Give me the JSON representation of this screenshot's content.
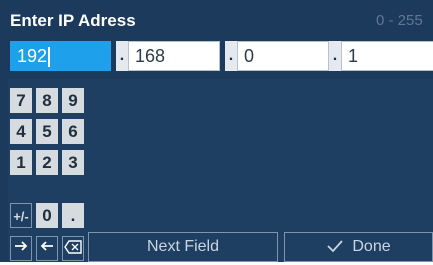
{
  "title": "Enter IP Adress",
  "range_hint": "0 - 255",
  "octets": [
    "192",
    "168",
    "0",
    "1"
  ],
  "separator": ".",
  "keypad": {
    "rows": [
      [
        "7",
        "8",
        "9"
      ],
      [
        "4",
        "5",
        "6"
      ],
      [
        "1",
        "2",
        "3"
      ],
      [
        "+/-",
        "0",
        "."
      ]
    ]
  },
  "actions": {
    "next_right_icon": "arrow-right-icon",
    "prev_left_icon": "arrow-left-icon",
    "backspace_icon": "backspace-icon",
    "next_field_label": "Next Field",
    "done_label": "Done",
    "done_icon": "checkmark-icon"
  },
  "colors": {
    "background": "#1b3a5c",
    "active_field": "#1ea0ea",
    "key_face": "#d6dbe0"
  }
}
